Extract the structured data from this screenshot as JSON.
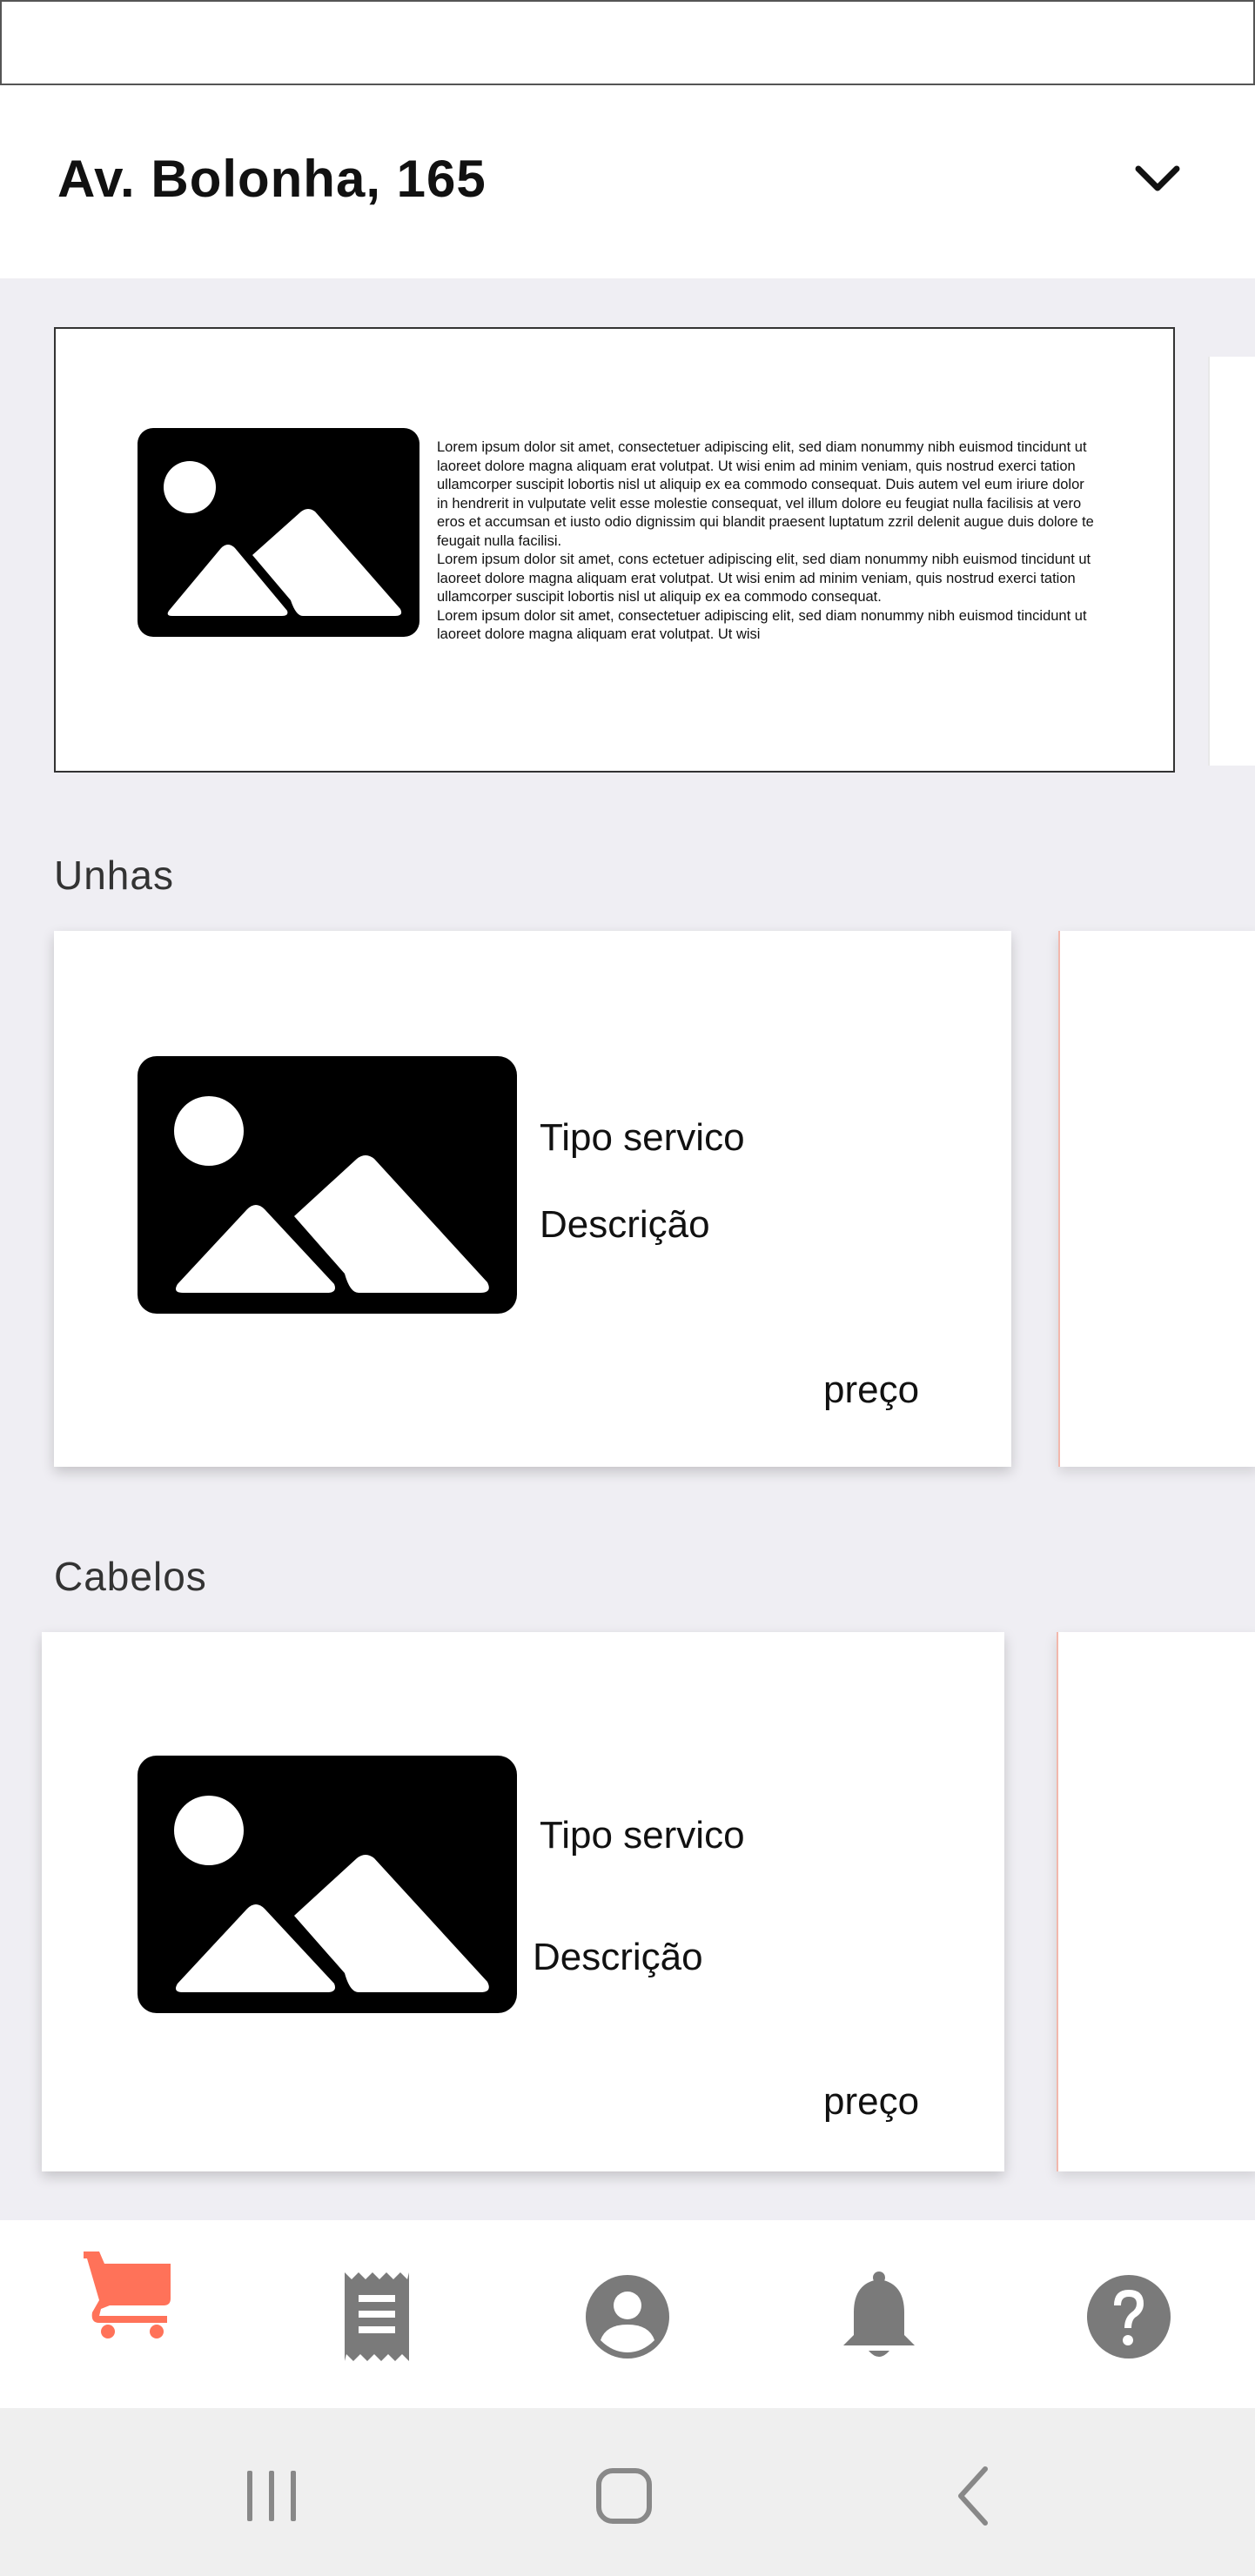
{
  "address": {
    "label": "Av. Bolonha, 165",
    "dropdown_icon": "chevron-down-icon"
  },
  "banner": {
    "image_icon": "image-placeholder-icon",
    "text_lines": [
      "Lorem ipsum dolor sit amet, consectetuer adipiscing elit, sed diam nonummy nibh euismod tincidunt ut",
      "laoreet dolore magna aliquam erat volutpat. Ut wisi enim ad minim veniam, quis nostrud exerci tation",
      "ullamcorper suscipit lobortis nisl ut aliquip ex ea commodo consequat. Duis autem vel eum iriure dolor",
      "in hendrerit in vulputate velit esse molestie consequat, vel illum dolore eu feugiat nulla facilisis at vero",
      "eros et accumsan et iusto odio dignissim qui blandit praesent luptatum zzril delenit augue duis dolore te",
      "feugait nulla facilisi.",
      "Lorem ipsum dolor sit amet, cons ectetuer adipiscing elit, sed diam nonummy nibh euismod tincidunt ut",
      "laoreet dolore magna aliquam erat volutpat. Ut wisi enim ad minim veniam, quis nostrud exerci tation",
      "ullamcorper suscipit lobortis nisl ut aliquip ex ea commodo consequat.",
      "Lorem ipsum dolor sit amet, consectetuer adipiscing elit, sed diam nonummy nibh euismod tincidunt ut",
      "laoreet dolore magna aliquam erat volutpat. Ut wisi"
    ]
  },
  "sections": [
    {
      "title": "Unhas",
      "card": {
        "service_type": "Tipo servico",
        "description": "Descrição",
        "price": "preço"
      }
    },
    {
      "title": "Cabelos",
      "card": {
        "service_type": "Tipo servico",
        "description": "Descrição",
        "price": "preço"
      }
    }
  ],
  "bottom_nav": {
    "items": [
      {
        "icon": "cart-icon",
        "active": true
      },
      {
        "icon": "receipt-icon",
        "active": false
      },
      {
        "icon": "account-icon",
        "active": false
      },
      {
        "icon": "bell-icon",
        "active": false
      },
      {
        "icon": "help-icon",
        "active": false
      }
    ],
    "active_color": "#ff7259",
    "inactive_color": "#7a7a7a"
  },
  "system_nav": {
    "items": [
      "recent-apps-icon",
      "home-icon",
      "back-icon"
    ]
  }
}
